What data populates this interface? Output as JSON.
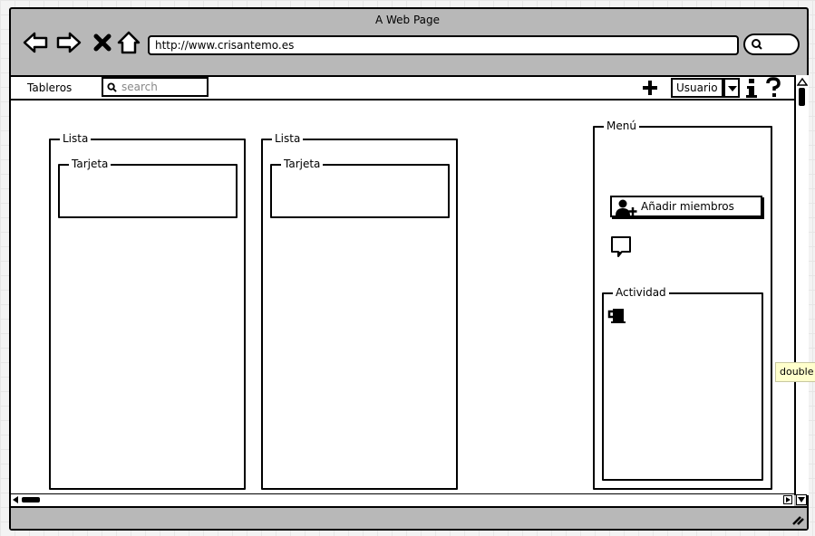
{
  "window": {
    "title": "A Web Page"
  },
  "address_bar": {
    "url": "http://www.crisantemo.es"
  },
  "toolbar": {
    "boards_label": "Tableros",
    "search_placeholder": "search",
    "user_label": "Usuario",
    "icons": [
      "plus-icon",
      "chevron-down-icon",
      "info-icon",
      "help-icon"
    ]
  },
  "lists": [
    {
      "title": "Lista",
      "cards": [
        {
          "title": "Tarjeta"
        }
      ]
    },
    {
      "title": "Lista",
      "cards": [
        {
          "title": "Tarjeta"
        }
      ]
    }
  ],
  "menu": {
    "title": "Menú",
    "add_members_label": "Añadir miembros",
    "activity_title": "Actividad"
  },
  "tooltip": {
    "text": "double"
  }
}
